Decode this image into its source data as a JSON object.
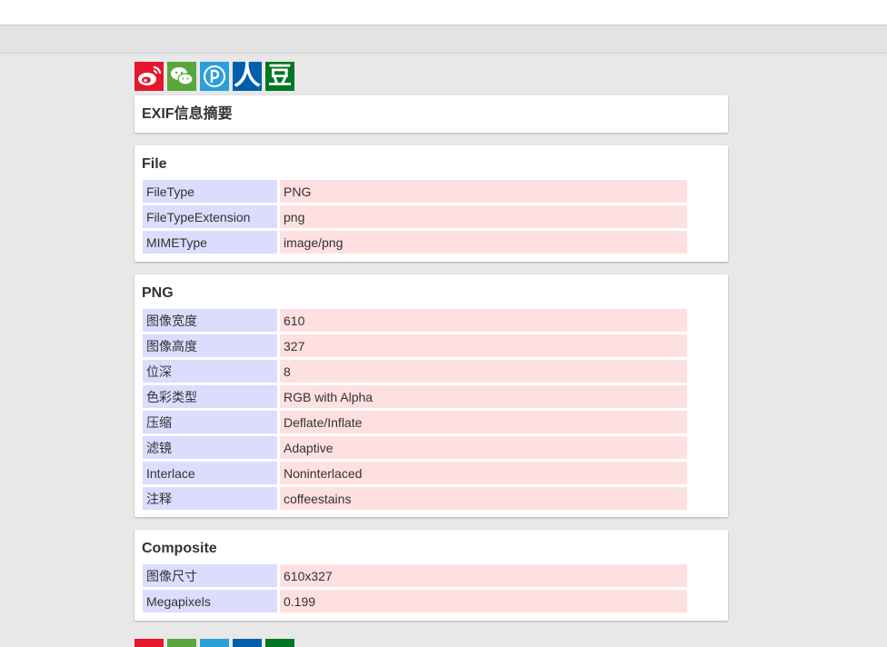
{
  "summary": {
    "title": "EXIF信息摘要"
  },
  "share": {
    "buttons": [
      {
        "name": "weibo",
        "color": "#e6162d"
      },
      {
        "name": "wechat",
        "color": "#5aa63c"
      },
      {
        "name": "qzone",
        "color": "#2ba0d8"
      },
      {
        "name": "renren",
        "color": "#005eac"
      },
      {
        "name": "douban",
        "color": "#007722"
      }
    ],
    "renren_glyph": "人",
    "douban_glyph": "豆"
  },
  "file": {
    "title": "File",
    "rows": [
      {
        "key": "FileType",
        "value": "PNG"
      },
      {
        "key": "FileTypeExtension",
        "value": "png"
      },
      {
        "key": "MIMEType",
        "value": "image/png"
      }
    ]
  },
  "png": {
    "title": "PNG",
    "rows": [
      {
        "key": "图像宽度",
        "value": "610"
      },
      {
        "key": "图像高度",
        "value": "327"
      },
      {
        "key": "位深",
        "value": "8"
      },
      {
        "key": "色彩类型",
        "value": "RGB with Alpha"
      },
      {
        "key": "压缩",
        "value": "Deflate/Inflate"
      },
      {
        "key": "滤镜",
        "value": "Adaptive"
      },
      {
        "key": "Interlace",
        "value": "Noninterlaced"
      },
      {
        "key": "注释",
        "value": "coffeestains"
      }
    ]
  },
  "composite": {
    "title": "Composite",
    "rows": [
      {
        "key": "图像尺寸",
        "value": "610x327"
      },
      {
        "key": "Megapixels",
        "value": "0.199"
      }
    ]
  }
}
